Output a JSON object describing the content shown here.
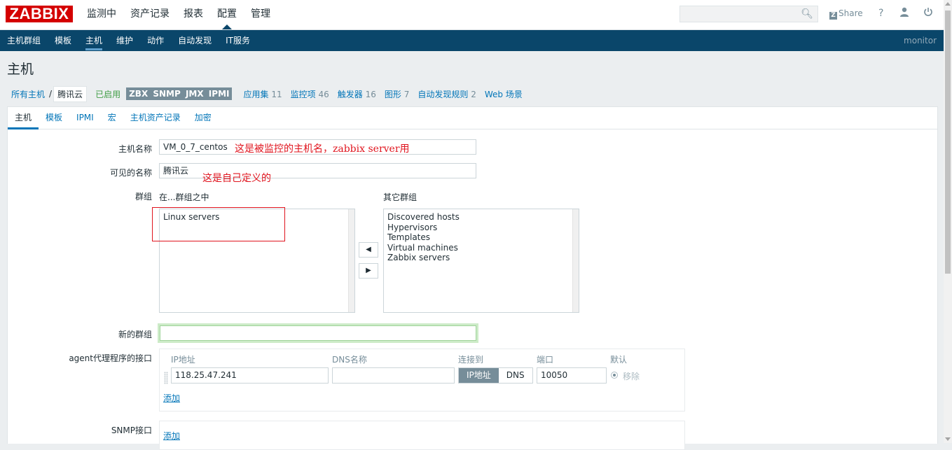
{
  "app": {
    "logo": "ZABBIX",
    "user": "monitor"
  },
  "main_menu": [
    "监测中",
    "资产记录",
    "报表",
    "配置",
    "管理"
  ],
  "header": {
    "search_placeholder": "",
    "share_label": "Share",
    "share_icon": "zabbix-z-icon",
    "help": "?",
    "icons": [
      "search-icon",
      "help-icon",
      "user-icon",
      "power-icon"
    ]
  },
  "sub_menu": [
    "主机群组",
    "模板",
    "主机",
    "维护",
    "动作",
    "自动发现",
    "IT服务"
  ],
  "page": {
    "title": "主机"
  },
  "breadcrumb": {
    "all_hosts": "所有主机",
    "sep": "/",
    "current": "腾讯云",
    "status": "已启用",
    "availability": "ZBX SNMP JMX IPMI",
    "links": [
      {
        "label": "应用集",
        "count": "11"
      },
      {
        "label": "监控项",
        "count": "46"
      },
      {
        "label": "触发器",
        "count": "16"
      },
      {
        "label": "图形",
        "count": "7"
      },
      {
        "label": "自动发现规则",
        "count": "2"
      },
      {
        "label": "Web 场景",
        "count": ""
      }
    ]
  },
  "tabs": [
    "主机",
    "模板",
    "IPMI",
    "宏",
    "主机资产记录",
    "加密"
  ],
  "form": {
    "hostname_label": "主机名称",
    "hostname_value": "VM_0_7_centos",
    "hostname_note": "这是被监控的主机名，zabbix server用",
    "visible_label": "可见的名称",
    "visible_value": "腾讯云",
    "visible_note": "这是自己定义的",
    "groups_label": "群组",
    "in_groups_header": "在...群组之中",
    "other_groups_header": "其它群组",
    "in_groups": [
      "Linux servers"
    ],
    "other_groups": [
      "Discovered hosts",
      "Hypervisors",
      "Templates",
      "Virtual machines",
      "Zabbix servers"
    ],
    "new_group_label": "新的群组",
    "new_group_value": "",
    "agent_label": "agent代理程序的接口",
    "agent_headers": {
      "ip": "IP地址",
      "dns": "DNS名称",
      "connect": "连接到",
      "port": "端口",
      "default": "默认"
    },
    "agent_row": {
      "ip": "118.25.47.241",
      "dns": "",
      "connect_ip": "IP地址",
      "connect_dns": "DNS",
      "port": "10050",
      "remove": "移除"
    },
    "add_label": "添加",
    "snmp_label": "SNMP接口"
  },
  "colors": {
    "accent": "#0275b8",
    "navbar": "#0a466a",
    "brand": "#d40000",
    "annotation": "#e0141e",
    "enabled": "#429e47"
  }
}
